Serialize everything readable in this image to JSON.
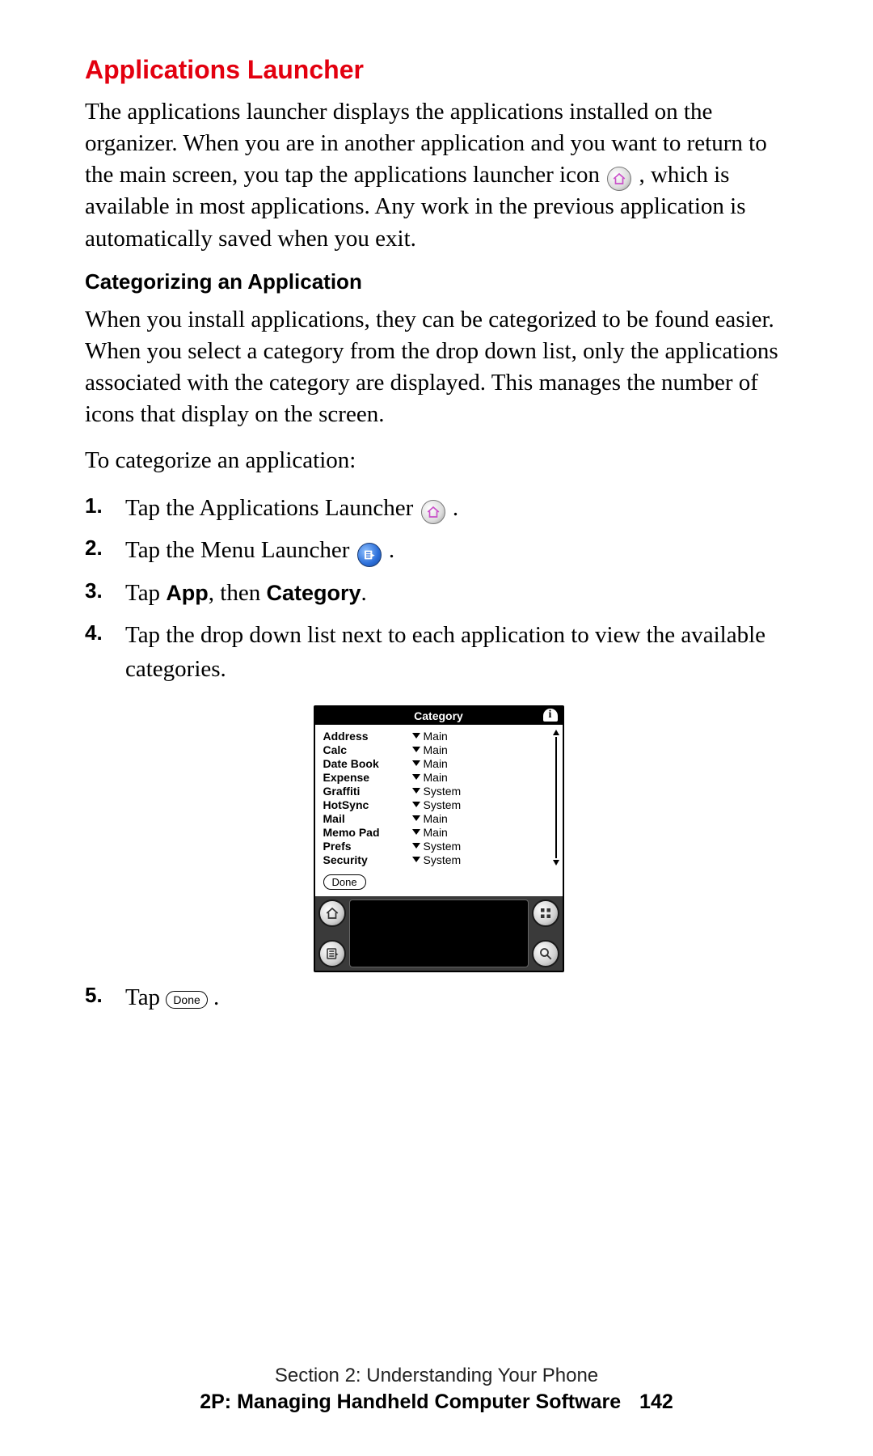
{
  "heading": "Applications Launcher",
  "para1_a": "The applications launcher displays the applications installed on the organizer. When you are in another application and you want to return to the main screen, you tap the applications launcher icon ",
  "para1_b": ", which is available in most applications. Any work in the previous application is automatically saved when you exit.",
  "subhead": "Categorizing an Application",
  "para2": "When you install applications, they can be categorized to be found easier. When you select a category from the drop down list, only the applications associated with the category are displayed. This manages the number of icons that display on the screen.",
  "para3": "To categorize an application:",
  "steps": {
    "s1": "Tap the Applications Launcher ",
    "s1_end": " .",
    "s2": "Tap the Menu Launcher ",
    "s2_end": ".",
    "s3_a": "Tap ",
    "s3_app": "App",
    "s3_mid": ", then ",
    "s3_cat": "Category",
    "s3_end": ".",
    "s4": "Tap the drop down list next to each application to view the available categories.",
    "s5": "Tap ",
    "s5_done": "Done",
    "s5_end": " ."
  },
  "device": {
    "title": "Category",
    "info": "i",
    "apps": [
      {
        "name": "Address",
        "cat": "Main"
      },
      {
        "name": "Calc",
        "cat": "Main"
      },
      {
        "name": "Date Book",
        "cat": "Main"
      },
      {
        "name": "Expense",
        "cat": "Main"
      },
      {
        "name": "Graffiti",
        "cat": "System"
      },
      {
        "name": "HotSync",
        "cat": "System"
      },
      {
        "name": "Mail",
        "cat": "Main"
      },
      {
        "name": "Memo Pad",
        "cat": "Main"
      },
      {
        "name": "Prefs",
        "cat": "System"
      },
      {
        "name": "Security",
        "cat": "System"
      }
    ],
    "done": "Done"
  },
  "footer": {
    "line1": "Section 2: Understanding Your Phone",
    "line2": "2P: Managing Handheld Computer Software",
    "page": "142"
  }
}
